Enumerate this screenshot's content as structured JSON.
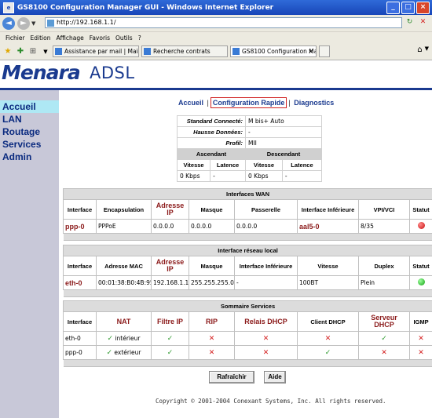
{
  "window": {
    "title": "GS8100 Configuration Manager GUI - Windows Internet Explorer"
  },
  "address": {
    "url": "http://192.168.1.1/"
  },
  "menu": [
    "Fichier",
    "Edition",
    "Affichage",
    "Favoris",
    "Outils",
    "?"
  ],
  "tabs": [
    {
      "label": "Assistance par mail | Mail assi..."
    },
    {
      "label": "Recherche contrats"
    },
    {
      "label": "GS8100 Configuration Ma..."
    }
  ],
  "logo": {
    "part1": "Menara",
    "part2": "ADSL"
  },
  "sidebar": {
    "items": [
      {
        "label": "Accueil"
      },
      {
        "label": "LAN"
      },
      {
        "label": "Routage"
      },
      {
        "label": "Services"
      },
      {
        "label": "Admin"
      }
    ]
  },
  "toplinks": {
    "accueil": "Accueil",
    "sep": "|",
    "rapide": "Configuration Rapide",
    "diag": "Diagnostics"
  },
  "status": {
    "standard_label": "Standard Connecté:",
    "standard_value": "M bis+ Auto",
    "hausse_label": "Hausse Données:",
    "hausse_value": "-",
    "profil_label": "Profil:",
    "profil_value": "MII",
    "ascendant": "Ascendant",
    "descendant": "Descendant",
    "vitesse": "Vitesse",
    "latence": "Latence",
    "up_speed": "0 Kbps",
    "up_latency": "-",
    "down_speed": "0 Kbps",
    "down_latency": "-"
  },
  "wan": {
    "title": "Interfaces WAN",
    "headers": [
      "Interface",
      "Encapsulation",
      "Adresse IP",
      "Masque",
      "Passerelle",
      "Interface Inférieure",
      "VPI/VCI",
      "Statut"
    ],
    "row": {
      "interface": "ppp-0",
      "encapsulation": "PPPoE",
      "ip": "0.0.0.0",
      "masque": "0.0.0.0",
      "passerelle": "0.0.0.0",
      "inferieure": "aal5-0",
      "vpivci": "8/35",
      "statut": "down"
    }
  },
  "lan": {
    "title": "Interface réseau local",
    "headers": [
      "Interface",
      "Adresse MAC",
      "Adresse IP",
      "Masque",
      "Interface Inférieure",
      "Vitesse",
      "Duplex",
      "Statut"
    ],
    "row": {
      "interface": "eth-0",
      "mac": "00:01:38:B0:4B:95",
      "ip": "192.168.1.1",
      "masque": "255.255.255.0",
      "inferieure": "-",
      "vitesse": "100BT",
      "duplex": "Plein",
      "statut": "up"
    }
  },
  "services": {
    "title": "Sommaire Services",
    "headers": [
      "Interface",
      "NAT",
      "Filtre IP",
      "RIP",
      "Relais DHCP",
      "Client DHCP",
      "Serveur DHCP",
      "IGMP"
    ],
    "rows": [
      {
        "interface": "eth-0",
        "nat": "intérieur"
      },
      {
        "interface": "ppp-0",
        "nat": "extérieur"
      }
    ],
    "colors": {
      "enabled": "#2e9a2e",
      "disabled": "#d42020"
    }
  },
  "buttons": {
    "refresh": "Rafraîchir",
    "help": "Aide"
  },
  "footer": {
    "copyright": "Copyright © 2001-2004 Conexant Systems, Inc. All rights reserved."
  }
}
